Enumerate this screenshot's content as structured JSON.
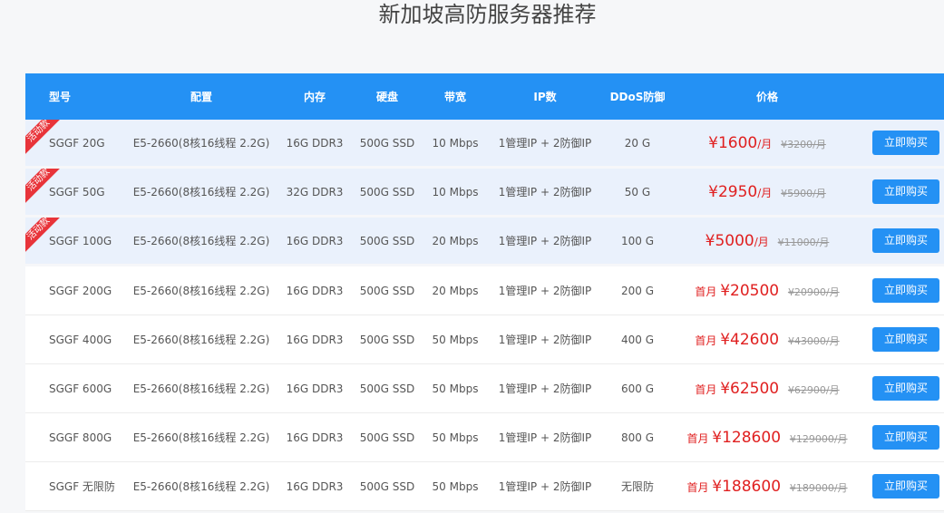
{
  "page_title": "新加坡高防服务器推荐",
  "headers": {
    "model": "型号",
    "cpu": "配置",
    "mem": "内存",
    "disk": "硬盘",
    "bw": "带宽",
    "ip": "IP数",
    "ddos": "DDoS防御",
    "price": "价格"
  },
  "rows": [
    {
      "badge": "活动款",
      "model": "SGGF 20G",
      "cpu": "E5-2660(8核16线程 2.2G)",
      "mem": "16G DDR3",
      "disk": "500G SSD",
      "bw": "10 Mbps",
      "ip": "1管理IP + 2防御IP",
      "ddos": "20 G",
      "prefix": "",
      "price": "¥1600",
      "unit": "/月",
      "old": "¥3200/月",
      "buy": "立即购买"
    },
    {
      "badge": "活动款",
      "model": "SGGF 50G",
      "cpu": "E5-2660(8核16线程 2.2G)",
      "mem": "32G DDR3",
      "disk": "500G SSD",
      "bw": "10 Mbps",
      "ip": "1管理IP + 2防御IP",
      "ddos": "50 G",
      "prefix": "",
      "price": "¥2950",
      "unit": "/月",
      "old": "¥5900/月",
      "buy": "立即购买"
    },
    {
      "badge": "活动款",
      "model": "SGGF 100G",
      "cpu": "E5-2660(8核16线程 2.2G)",
      "mem": "16G DDR3",
      "disk": "500G SSD",
      "bw": "20 Mbps",
      "ip": "1管理IP + 2防御IP",
      "ddos": "100 G",
      "prefix": "",
      "price": "¥5000",
      "unit": "/月",
      "old": "¥11000/月",
      "buy": "立即购买"
    },
    {
      "badge": "",
      "model": "SGGF 200G",
      "cpu": "E5-2660(8核16线程 2.2G)",
      "mem": "16G DDR3",
      "disk": "500G SSD",
      "bw": "20 Mbps",
      "ip": "1管理IP + 2防御IP",
      "ddos": "200 G",
      "prefix": "首月",
      "price": "¥20500",
      "unit": "",
      "old": "¥20900/月",
      "buy": "立即购买"
    },
    {
      "badge": "",
      "model": "SGGF 400G",
      "cpu": "E5-2660(8核16线程 2.2G)",
      "mem": "16G DDR3",
      "disk": "500G SSD",
      "bw": "50 Mbps",
      "ip": "1管理IP + 2防御IP",
      "ddos": "400 G",
      "prefix": "首月",
      "price": "¥42600",
      "unit": "",
      "old": "¥43000/月",
      "buy": "立即购买"
    },
    {
      "badge": "",
      "model": "SGGF 600G",
      "cpu": "E5-2660(8核16线程 2.2G)",
      "mem": "16G DDR3",
      "disk": "500G SSD",
      "bw": "50 Mbps",
      "ip": "1管理IP + 2防御IP",
      "ddos": "600 G",
      "prefix": "首月",
      "price": "¥62500",
      "unit": "",
      "old": "¥62900/月",
      "buy": "立即购买"
    },
    {
      "badge": "",
      "model": "SGGF 800G",
      "cpu": "E5-2660(8核16线程 2.2G)",
      "mem": "16G DDR3",
      "disk": "500G SSD",
      "bw": "50 Mbps",
      "ip": "1管理IP + 2防御IP",
      "ddos": "800 G",
      "prefix": "首月",
      "price": "¥128600",
      "unit": "",
      "old": "¥129000/月",
      "buy": "立即购买"
    },
    {
      "badge": "",
      "model": "SGGF 无限防",
      "cpu": "E5-2660(8核16线程 2.2G)",
      "mem": "16G DDR3",
      "disk": "500G SSD",
      "bw": "50 Mbps",
      "ip": "1管理IP + 2防御IP",
      "ddos": "无限防",
      "prefix": "首月",
      "price": "¥188600",
      "unit": "",
      "old": "¥189000/月",
      "buy": "立即购买"
    }
  ],
  "colors": {
    "header_bg": "#2491f4",
    "price": "#e02020",
    "badge": "#e8343a",
    "promo_row_bg": "#eaf1fc"
  }
}
